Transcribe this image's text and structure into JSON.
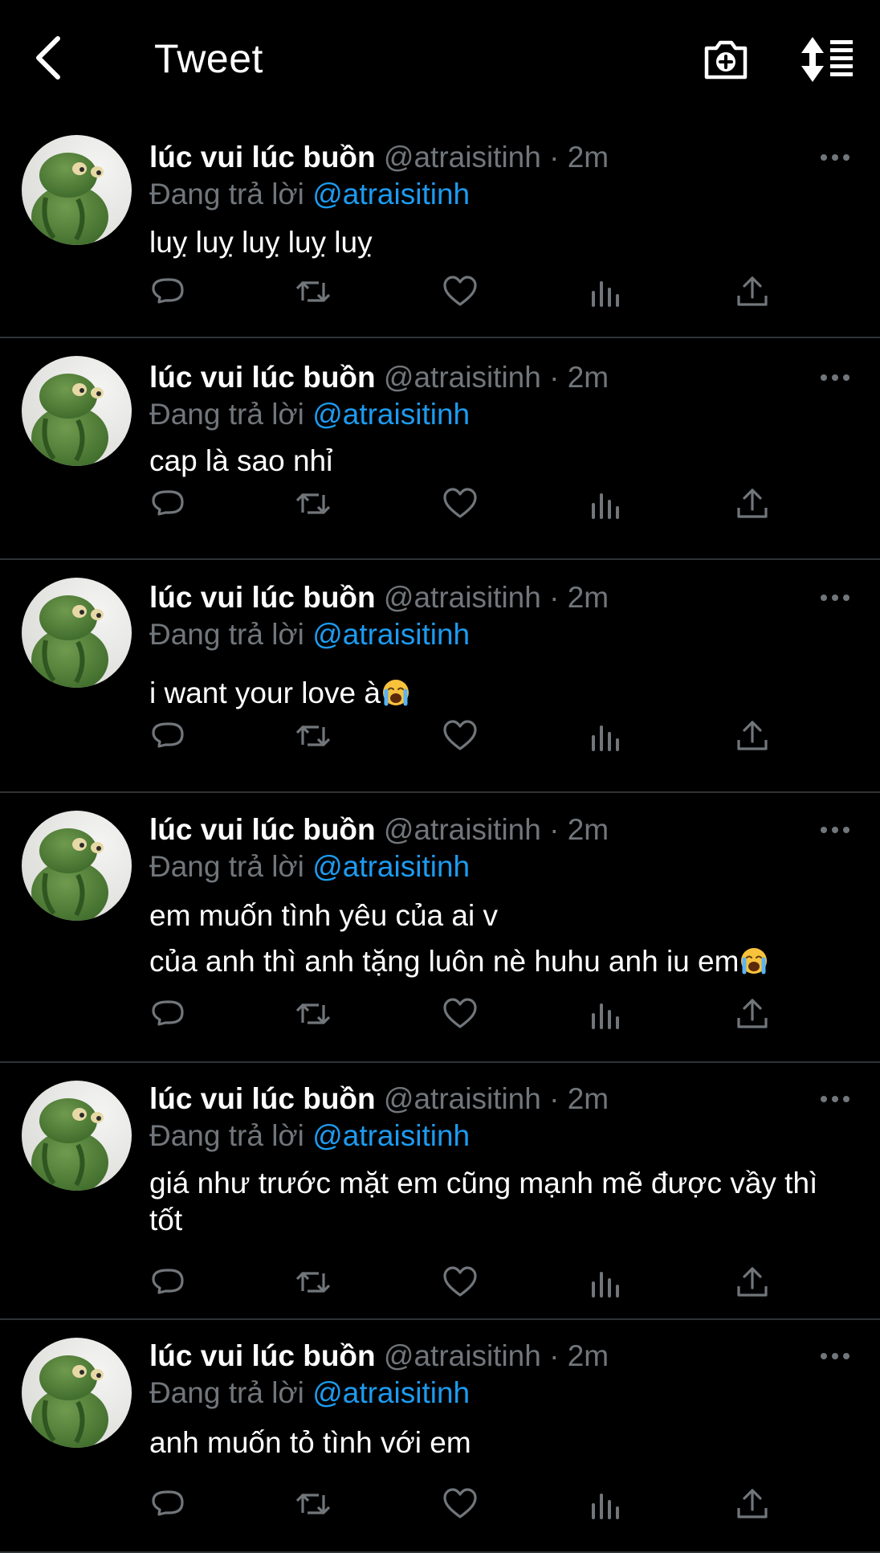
{
  "header": {
    "title": "Tweet",
    "back_icon": "chevron-left-icon",
    "camera_icon": "camera-plus-icon",
    "sort_icon": "sort-list-icon"
  },
  "tweets": [
    {
      "name": "lúc vui lúc buồn",
      "handle": "@atraisitinh",
      "dot": "·",
      "time": "2m",
      "reply_prefix": "Đang trả lời",
      "reply_to": "@atraisitinh",
      "lines": [
        "luỵ luỵ luỵ luỵ luỵ"
      ]
    },
    {
      "name": "lúc vui lúc buồn",
      "handle": "@atraisitinh",
      "dot": "·",
      "time": "2m",
      "reply_prefix": "Đang trả lời",
      "reply_to": "@atraisitinh",
      "lines": [
        "cap là sao nhỉ"
      ]
    },
    {
      "name": "lúc vui lúc buồn",
      "handle": "@atraisitinh",
      "dot": "·",
      "time": "2m",
      "reply_prefix": "Đang trả lời",
      "reply_to": "@atraisitinh",
      "lines": [
        "i want your love à"
      ]
    },
    {
      "name": "lúc vui lúc buồn",
      "handle": "@atraisitinh",
      "dot": "·",
      "time": "2m",
      "reply_prefix": "Đang trả lời",
      "reply_to": "@atraisitinh",
      "lines": [
        "em muốn tình yêu của ai v",
        "của anh thì anh tặng luôn nè huhu anh iu em"
      ]
    },
    {
      "name": "lúc vui lúc buồn",
      "handle": "@atraisitinh",
      "dot": "·",
      "time": "2m",
      "reply_prefix": "Đang trả lời",
      "reply_to": "@atraisitinh",
      "lines": [
        "giá như trước mặt em cũng mạnh mẽ được vầy thì tốt"
      ]
    },
    {
      "name": "lúc vui lúc buồn",
      "handle": "@atraisitinh",
      "dot": "·",
      "time": "2m",
      "reply_prefix": "Đang trả lời",
      "reply_to": "@atraisitinh",
      "lines": [
        "anh muốn tỏ tình với em"
      ]
    }
  ],
  "emoji": "loudly-crying-face-emoji",
  "action_icons": [
    "reply-icon",
    "retweet-icon",
    "like-icon",
    "views-icon",
    "share-icon"
  ],
  "colors": {
    "background": "#000000",
    "text": "#ffffff",
    "secondary": "#71767b",
    "accent": "#1d9bf0",
    "divider": "#2f3336"
  }
}
